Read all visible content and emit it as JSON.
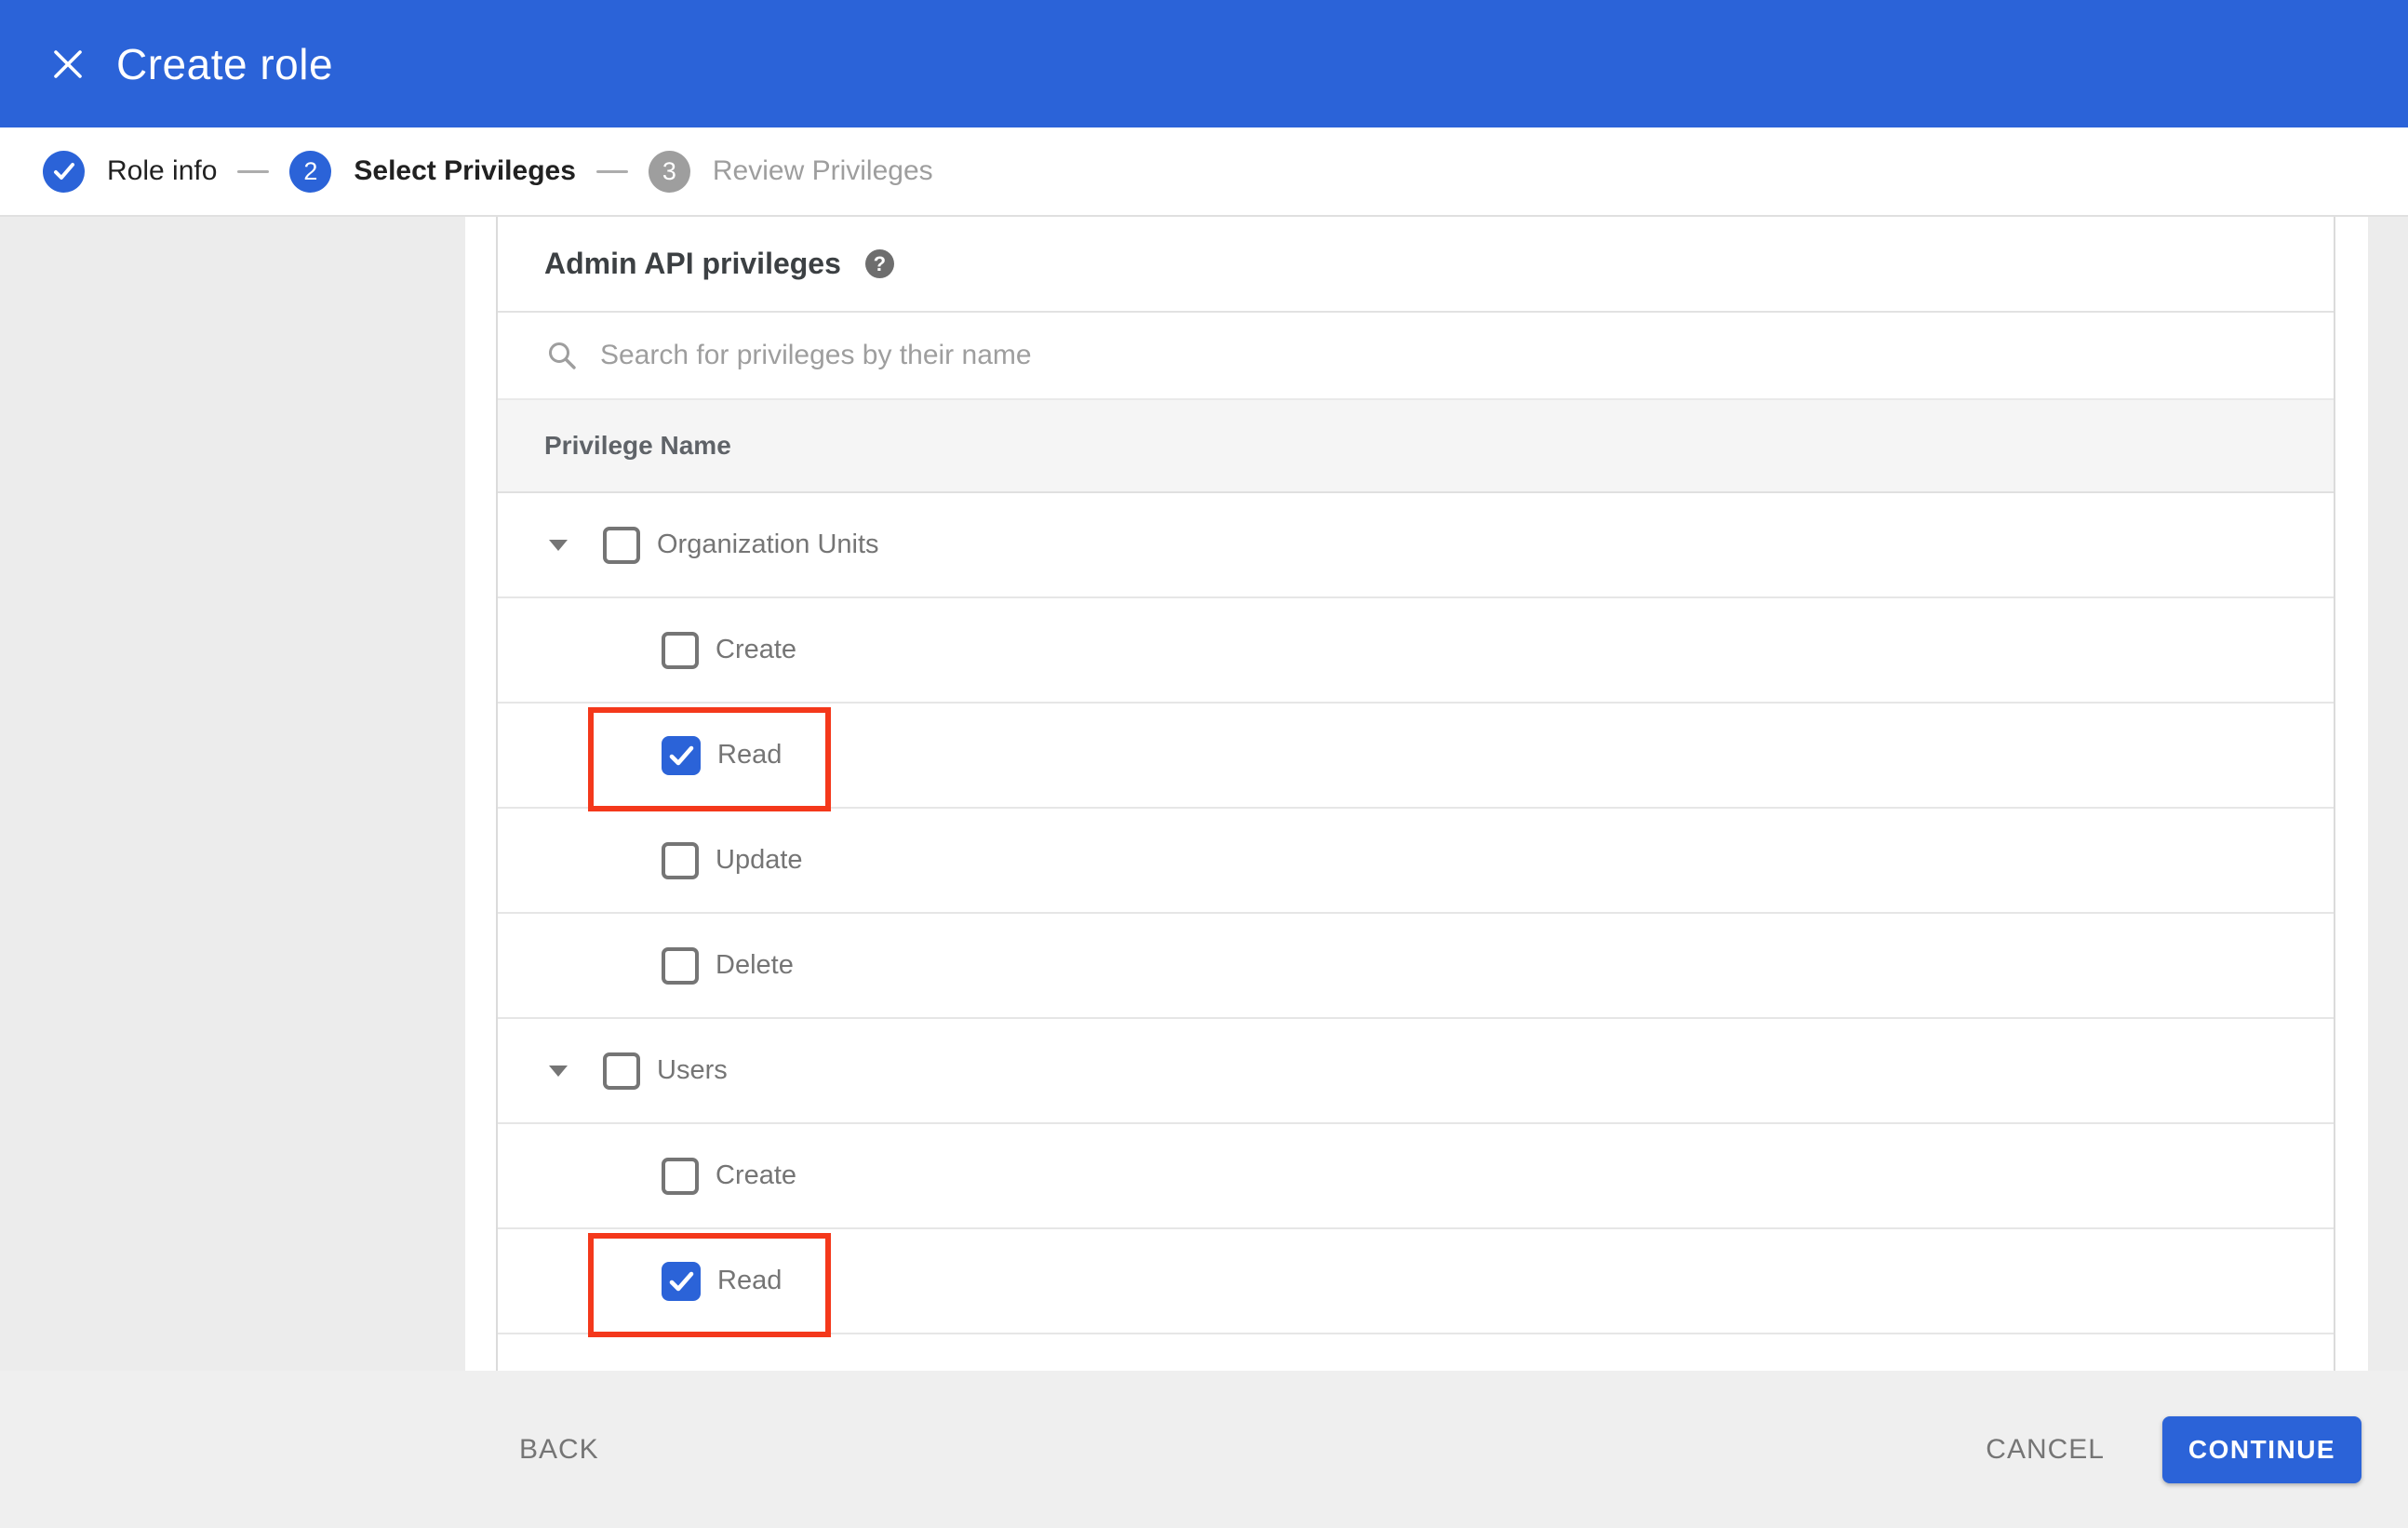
{
  "header": {
    "title": "Create role"
  },
  "stepper": {
    "steps": [
      {
        "number": "1",
        "label": "Role info",
        "state": "completed"
      },
      {
        "number": "2",
        "label": "Select Privileges",
        "state": "active"
      },
      {
        "number": "3",
        "label": "Review Privileges",
        "state": "upcoming"
      }
    ]
  },
  "main": {
    "section_title": "Admin API privileges",
    "help_glyph": "?",
    "search": {
      "value": "",
      "placeholder": "Search for privileges by their name"
    },
    "table": {
      "column_header": "Privilege Name",
      "rows": [
        {
          "label": "Organization Units",
          "type": "group",
          "expanded": true,
          "checked": false,
          "highlighted": false
        },
        {
          "label": "Create",
          "type": "child",
          "checked": false,
          "highlighted": false
        },
        {
          "label": "Read",
          "type": "child",
          "checked": true,
          "highlighted": true
        },
        {
          "label": "Update",
          "type": "child",
          "checked": false,
          "highlighted": false
        },
        {
          "label": "Delete",
          "type": "child",
          "checked": false,
          "highlighted": false
        },
        {
          "label": "Users",
          "type": "group",
          "expanded": true,
          "checked": false,
          "highlighted": false
        },
        {
          "label": "Create",
          "type": "child",
          "checked": false,
          "highlighted": false
        },
        {
          "label": "Read",
          "type": "child",
          "checked": true,
          "highlighted": true
        }
      ]
    }
  },
  "footer": {
    "back_label": "BACK",
    "cancel_label": "CANCEL",
    "continue_label": "CONTINUE"
  },
  "colors": {
    "accent_blue": "#2b63d8",
    "highlight_red": "#f4381b",
    "inactive_gray": "#9e9e9e",
    "row_text_gray": "#757575",
    "footer_bg": "#efefef",
    "sidebar_bg": "#ececec"
  }
}
